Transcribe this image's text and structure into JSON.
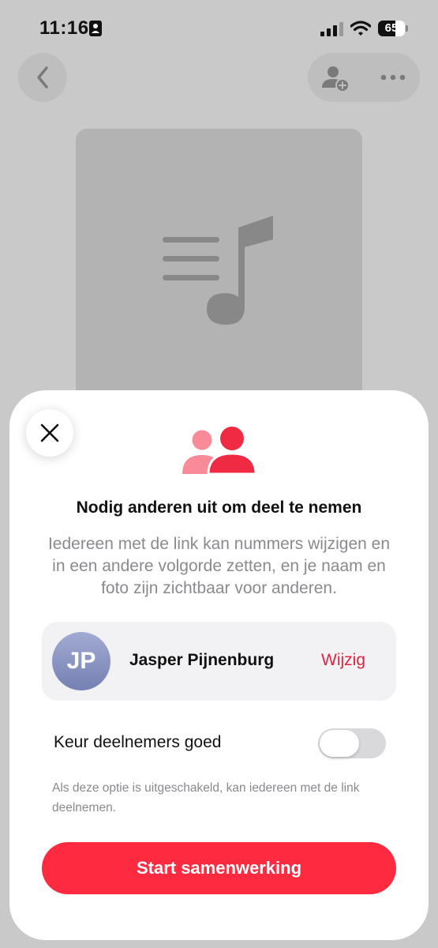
{
  "status_bar": {
    "time": "11:16",
    "battery": "65",
    "battery_level": 0.65
  },
  "background": {
    "back_icon": "chevron-left-icon",
    "add_person_icon": "person-add-icon",
    "more_icon": "ellipsis-icon",
    "artwork_icon": "music-list-icon"
  },
  "sheet": {
    "title": "Nodig anderen uit om deel te nemen",
    "description": "Iedereen met de link kan nummers wijzigen en in een andere volgorde zetten, en je naam en foto zijn zichtbaar voor anderen.",
    "user": {
      "initials": "JP",
      "name": "Jasper Pijnenburg",
      "action": "Wijzig"
    },
    "approve_label": "Keur deelnemers goed",
    "approve_enabled": false,
    "helper": "Als deze optie is uitgeschakeld, kan iedereen met de link deelnemen.",
    "start_button": "Start samenwerking"
  },
  "colors": {
    "accent": "#fe2a40",
    "link": "#e0243f",
    "people_light": "#f88b97",
    "people_dark": "#f02a43"
  }
}
